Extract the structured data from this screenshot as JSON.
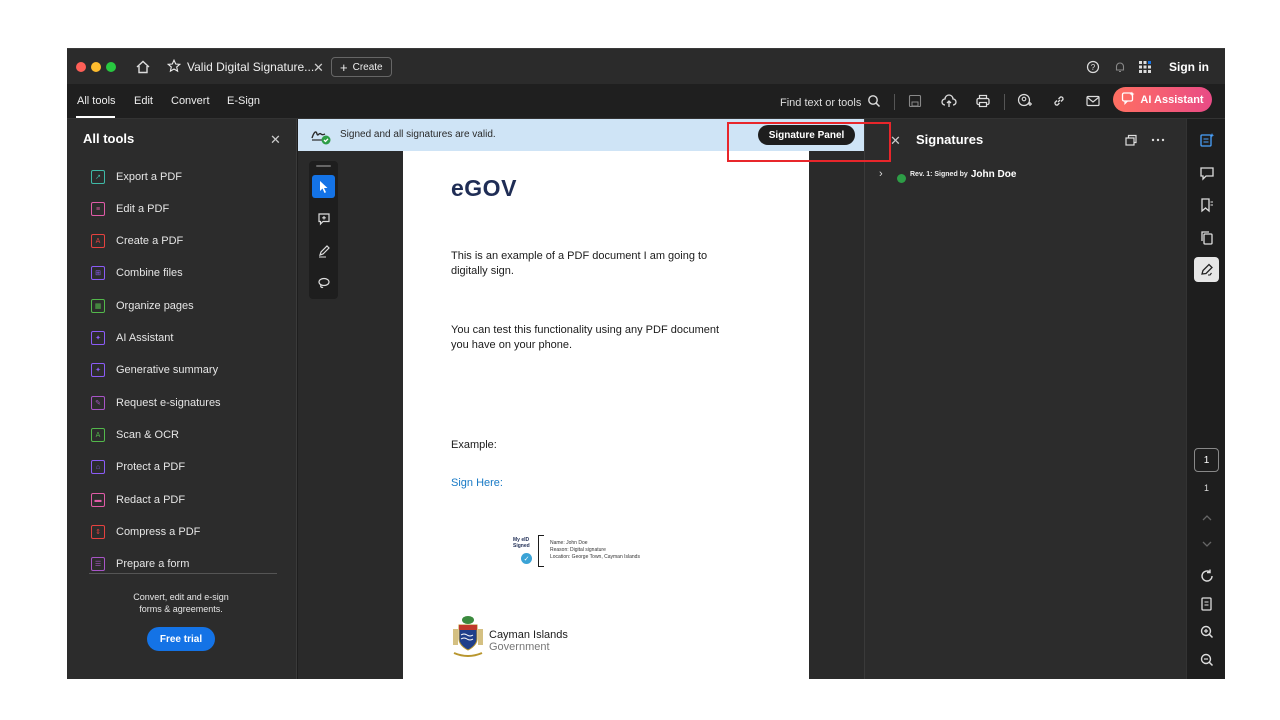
{
  "window": {
    "tab_title": "Valid Digital Signature...",
    "create_label": "Create",
    "signin_label": "Sign in"
  },
  "menubar": {
    "items": [
      "All tools",
      "Edit",
      "Convert",
      "E-Sign"
    ],
    "find_label": "Find text or tools",
    "ai_label": "AI Assistant"
  },
  "left_panel": {
    "title": "All tools",
    "tools": [
      {
        "label": "Export a PDF",
        "color": "#3fb9a6"
      },
      {
        "label": "Edit a PDF",
        "color": "#e05ba7"
      },
      {
        "label": "Create a PDF",
        "color": "#e6423f"
      },
      {
        "label": "Combine files",
        "color": "#8b5cf6"
      },
      {
        "label": "Organize pages",
        "color": "#53b84b"
      },
      {
        "label": "AI Assistant",
        "color": "#8b5cf6"
      },
      {
        "label": "Generative summary",
        "color": "#8b5cf6"
      },
      {
        "label": "Request e-signatures",
        "color": "#a855c7"
      },
      {
        "label": "Scan & OCR",
        "color": "#53b84b"
      },
      {
        "label": "Protect a PDF",
        "color": "#8b5cf6"
      },
      {
        "label": "Redact a PDF",
        "color": "#e05ba7"
      },
      {
        "label": "Compress a PDF",
        "color": "#e6423f"
      },
      {
        "label": "Prepare a form",
        "color": "#a855c7"
      }
    ],
    "promo_text_1": "Convert, edit and e-sign",
    "promo_text_2": "forms & agreements.",
    "free_trial_label": "Free trial"
  },
  "banner": {
    "text": "Signed and all signatures are valid.",
    "button_label": "Signature Panel"
  },
  "document": {
    "logo": "eGOV",
    "paragraph_1_line_1": "This is an example of a PDF document I am going to",
    "paragraph_1_line_2": "digitally sign.",
    "paragraph_2_line_1": "You can test this functionality using any PDF document",
    "paragraph_2_line_2": "you have on your phone.",
    "example_label": "Example:",
    "sign_here_label": "Sign Here:",
    "stamp": {
      "brand": "My eID Signed",
      "name_line": "Name:  John Doe",
      "reason_line": "Reason:  Digital signature",
      "location_line": "Location:  George Town, Cayman Islands"
    },
    "footer_title": "Cayman Islands",
    "footer_subtitle": "Government"
  },
  "signatures_panel": {
    "title": "Signatures",
    "rev_label": "Rev. 1: Signed by",
    "signer": "John Doe"
  },
  "right_rail": {
    "current_page": "1",
    "total_pages": "1"
  },
  "colors": {
    "accent_blue": "#1473e6",
    "banner_bg": "#cfe4f6",
    "highlight_red": "#e8262b",
    "valid_green": "#2d9d46"
  }
}
